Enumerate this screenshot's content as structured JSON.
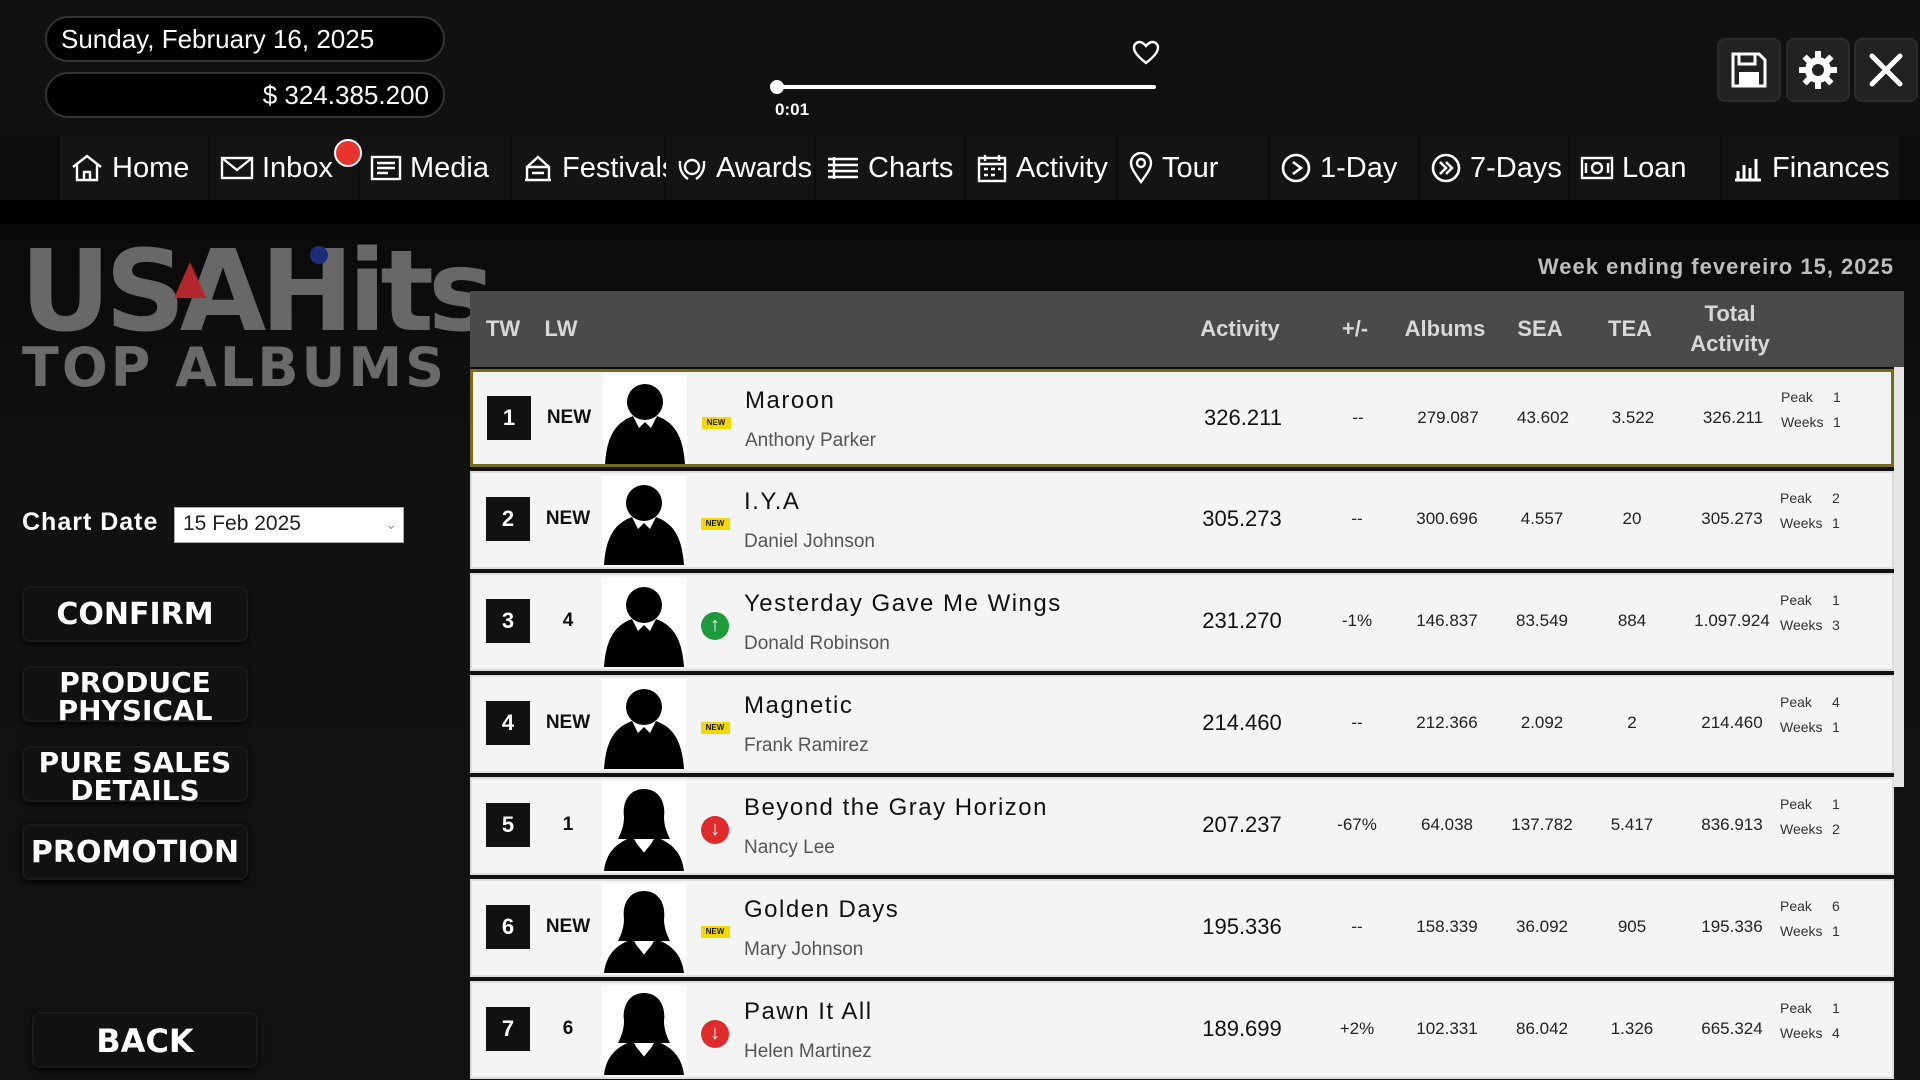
{
  "topbar": {
    "date": "Sunday, February 16, 2025",
    "money": "$ 324.385.200",
    "time": "0:01",
    "progress": 0.0
  },
  "nav": {
    "items": [
      {
        "label": "Home",
        "icon": "home-icon"
      },
      {
        "label": "Inbox",
        "icon": "inbox-icon"
      },
      {
        "label": "Media",
        "icon": "media-icon"
      },
      {
        "label": "Festivals",
        "icon": "festival-icon"
      },
      {
        "label": "Awards",
        "icon": "awards-icon"
      },
      {
        "label": "Charts",
        "icon": "charts-icon"
      },
      {
        "label": "Activity",
        "icon": "calendar-icon"
      },
      {
        "label": "Tour",
        "icon": "location-pin-icon"
      },
      {
        "label": "1-Day",
        "icon": "play-icon"
      },
      {
        "label": "7-Days",
        "icon": "fast-forward-icon"
      },
      {
        "label": "Loan",
        "icon": "loan-icon"
      },
      {
        "label": "Finances",
        "icon": "finances-icon"
      }
    ]
  },
  "logo": {
    "line1": "USAHits",
    "line2": "TOP ALBUMS"
  },
  "left": {
    "chart_date_label": "Chart Date",
    "chart_date_value": "15 Feb 2025",
    "confirm": "CONFIRM",
    "produce_1": "PRODUCE",
    "produce_2": "PHYSICAL",
    "pure_1": "PURE SALES",
    "pure_2": "DETAILS",
    "promotion": "PROMOTION",
    "back": "BACK"
  },
  "chart": {
    "week_ending": "Week ending fevereiro 15, 2025",
    "headers": {
      "tw": "TW",
      "lw": "LW",
      "activity": "Activity",
      "change": "+/-",
      "albums": "Albums",
      "sea": "SEA",
      "tea": "TEA",
      "total_1": "Total",
      "total_2": "Activity"
    },
    "peak_label": "Peak",
    "weeks_label": "Weeks",
    "rows": [
      {
        "tw": "1",
        "lw": "NEW",
        "status": "new",
        "title": "Maroon",
        "artist": "Anthony Parker",
        "gender": "m",
        "activity": "326.211",
        "change": "--",
        "albums": "279.087",
        "sea": "43.602",
        "tea": "3.522",
        "total": "326.211",
        "peak": "1",
        "weeks": "1"
      },
      {
        "tw": "2",
        "lw": "NEW",
        "status": "new",
        "title": "I.Y.A",
        "artist": "Daniel Johnson",
        "gender": "m",
        "activity": "305.273",
        "change": "--",
        "albums": "300.696",
        "sea": "4.557",
        "tea": "20",
        "total": "305.273",
        "peak": "2",
        "weeks": "1"
      },
      {
        "tw": "3",
        "lw": "4",
        "status": "up",
        "title": "Yesterday Gave Me Wings",
        "artist": "Donald Robinson",
        "gender": "m",
        "activity": "231.270",
        "change": "-1%",
        "albums": "146.837",
        "sea": "83.549",
        "tea": "884",
        "total": "1.097.924",
        "peak": "1",
        "weeks": "3"
      },
      {
        "tw": "4",
        "lw": "NEW",
        "status": "new",
        "title": "Magnetic",
        "artist": "Frank Ramirez",
        "gender": "m",
        "activity": "214.460",
        "change": "--",
        "albums": "212.366",
        "sea": "2.092",
        "tea": "2",
        "total": "214.460",
        "peak": "4",
        "weeks": "1"
      },
      {
        "tw": "5",
        "lw": "1",
        "status": "down",
        "title": "Beyond the Gray Horizon",
        "artist": "Nancy Lee",
        "gender": "f",
        "activity": "207.237",
        "change": "-67%",
        "albums": "64.038",
        "sea": "137.782",
        "tea": "5.417",
        "total": "836.913",
        "peak": "1",
        "weeks": "2"
      },
      {
        "tw": "6",
        "lw": "NEW",
        "status": "new",
        "title": "Golden Days",
        "artist": "Mary Johnson",
        "gender": "f",
        "activity": "195.336",
        "change": "--",
        "albums": "158.339",
        "sea": "36.092",
        "tea": "905",
        "total": "195.336",
        "peak": "6",
        "weeks": "1"
      },
      {
        "tw": "7",
        "lw": "6",
        "status": "down",
        "title": "Pawn It All",
        "artist": "Helen Martinez",
        "gender": "f",
        "activity": "189.699",
        "change": "+2%",
        "albums": "102.331",
        "sea": "86.042",
        "tea": "1.326",
        "total": "665.324",
        "peak": "1",
        "weeks": "4"
      }
    ],
    "new_tag": "NEW"
  }
}
